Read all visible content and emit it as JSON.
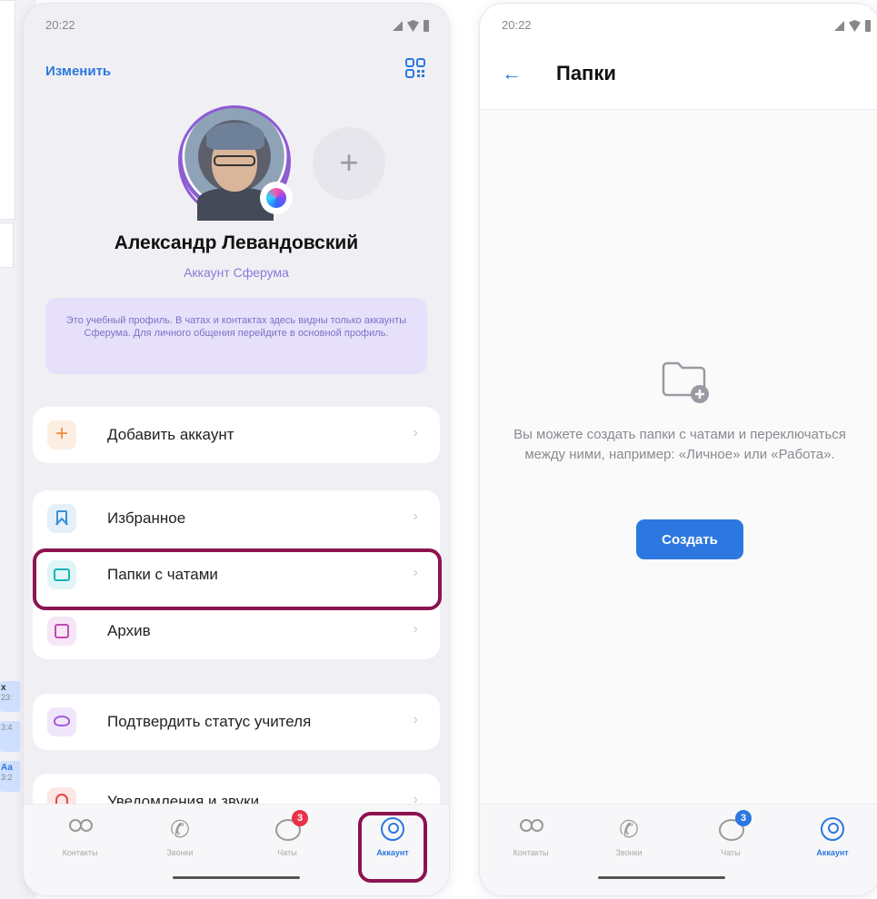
{
  "background_panel": {
    "chat_snippets": [
      {
        "text": "х",
        "time": "23:"
      },
      {
        "text": "",
        "time": "3:4"
      },
      {
        "text": "Аа",
        "time": "3:2"
      }
    ]
  },
  "left_phone": {
    "status_time": "20:22",
    "edit_label": "Изменить",
    "qr_icon": "qr-code-icon",
    "profile": {
      "name": "Александр Левандовский",
      "subtitle": "Аккаунт Сферума",
      "add_account_symbol": "+"
    },
    "notice": "Это учебный профиль. В чатах и контактах здесь видны только аккаунты Сферума. Для личного общения перейдите в основной профиль.",
    "menu": {
      "add_account": "Добавить аккаунт",
      "favorites": "Избранное",
      "folders": "Папки с чатами",
      "archive": "Архив",
      "teacher": "Подтвердить статус учителя",
      "notifications": "Уведомления и звуки"
    },
    "chevron": "›",
    "tabs": [
      {
        "label": "Контакты",
        "icon": "contacts-icon"
      },
      {
        "label": "Звонки",
        "icon": "calls-icon"
      },
      {
        "label": "Чаты",
        "icon": "chats-icon",
        "badge": "3"
      },
      {
        "label": "Аккаунт",
        "icon": "account-icon",
        "active": true
      }
    ],
    "highlight_color": "#8c1450"
  },
  "right_phone": {
    "status_time": "20:22",
    "back_arrow": "←",
    "title": "Папки",
    "empty_text": "Вы можете создать папки с чатами и переключаться между ними, например: «Личное» или «Работа».",
    "create_button": "Создать",
    "tabs": [
      {
        "label": "Контакты",
        "icon": "contacts-icon"
      },
      {
        "label": "Звонки",
        "icon": "calls-icon"
      },
      {
        "label": "Чаты",
        "icon": "chats-icon",
        "badge": "3"
      },
      {
        "label": "Аккаунт",
        "icon": "account-icon",
        "active": true
      }
    ]
  },
  "colors": {
    "accent": "#2c78e0",
    "badge_red": "#e8334a",
    "badge_blue": "#2c78e0",
    "notice_bg": "#e6e0fb",
    "highlight": "#8c1450"
  }
}
